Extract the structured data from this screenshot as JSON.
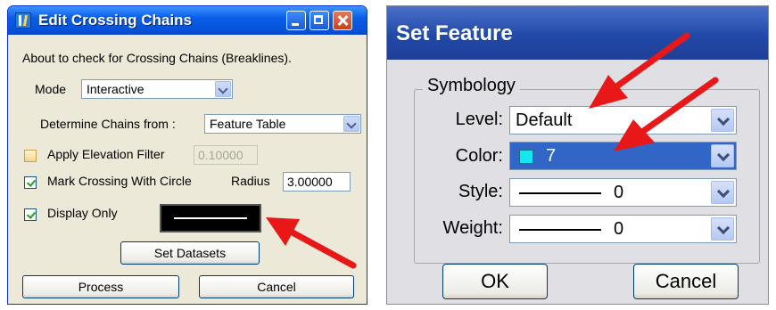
{
  "edit_crossing_chains": {
    "title": "Edit Crossing Chains",
    "description": "About to check for Crossing Chains (Breaklines).",
    "mode": {
      "label": "Mode",
      "value": "Interactive"
    },
    "determine": {
      "label": "Determine Chains from :",
      "value": "Feature Table"
    },
    "apply_elevation": {
      "label": "Apply Elevation Filter",
      "checked": false,
      "value": "0.10000"
    },
    "mark_crossing": {
      "label": "Mark Crossing With Circle",
      "checked": true
    },
    "radius": {
      "label": "Radius",
      "value": "3.00000"
    },
    "display_only": {
      "label": "Display Only",
      "checked": true
    },
    "set_datasets_label": "Set Datasets",
    "process_label": "Process",
    "cancel_label": "Cancel"
  },
  "set_feature": {
    "title": "Set Feature",
    "group_label": "Symbology",
    "level": {
      "label": "Level:",
      "value": "Default"
    },
    "color": {
      "label": "Color:",
      "value": "7",
      "swatch": "#12e8f0"
    },
    "style": {
      "label": "Style:",
      "value": "0"
    },
    "weight": {
      "label": "Weight:",
      "value": "0"
    },
    "ok_label": "OK",
    "cancel_label": "Cancel"
  },
  "colors": {
    "annotation_arrow": "#e81818",
    "xp_title": "#0a5ee8",
    "dialog_title": "#2149a8"
  }
}
